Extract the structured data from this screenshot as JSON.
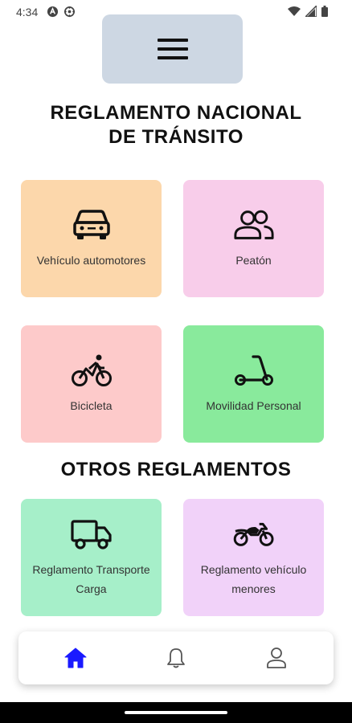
{
  "status_bar": {
    "time": "4:34",
    "left_icons": [
      "accessibility-icon",
      "settings-icon"
    ],
    "right_icons": [
      "wifi-icon",
      "signal-icon",
      "battery-icon"
    ]
  },
  "header": {
    "menu_icon": "hamburger-icon",
    "menu_bg": "#cdd7e3"
  },
  "main_title": {
    "line1": "REGLAMENTO NACIONAL",
    "line2": "DE TRÁNSITO"
  },
  "main_cards": [
    {
      "label": "Vehículo automotores",
      "icon": "car-icon",
      "color": "#fcd7ab"
    },
    {
      "label": "Peatón",
      "icon": "people-icon",
      "color": "#f8cdea"
    },
    {
      "label": "Bicicleta",
      "icon": "bicycle-icon",
      "color": "#fdcaca"
    },
    {
      "label": "Movilidad Personal",
      "icon": "scooter-icon",
      "color": "#89ea9c"
    }
  ],
  "other_title": "OTROS REGLAMENTOS",
  "other_cards": [
    {
      "label": "Reglamento Transporte Carga",
      "icon": "truck-icon",
      "color": "#a6efc9"
    },
    {
      "label": "Reglamento vehículo menores",
      "icon": "motorcycle-icon",
      "color": "#f1d2f9"
    }
  ],
  "bottom_nav": {
    "items": [
      {
        "icon": "home-icon",
        "active": true
      },
      {
        "icon": "bell-icon",
        "active": false
      },
      {
        "icon": "user-icon",
        "active": false
      }
    ],
    "active_color": "#1a1aff",
    "inactive_color": "#555555"
  }
}
